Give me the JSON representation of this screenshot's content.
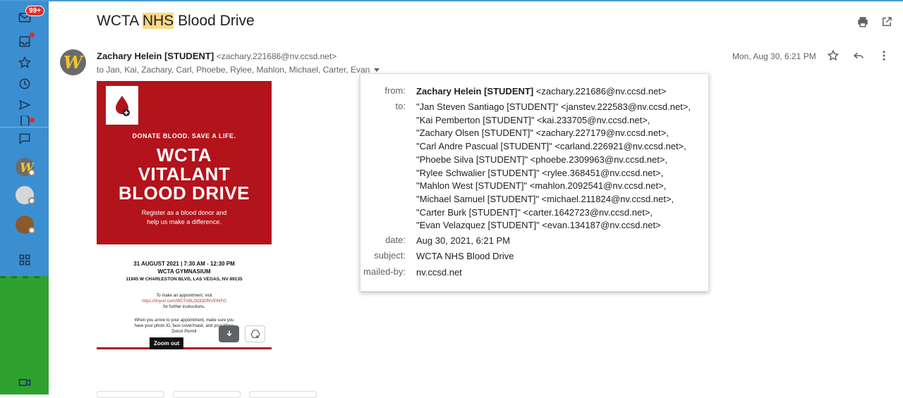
{
  "rail": {
    "mail_badge": "99+",
    "icons": [
      "mail-icon",
      "inbox-icon",
      "star-icon",
      "clock-icon",
      "send-icon",
      "draft-icon",
      "chat-icon",
      "apps-icon",
      "video-icon"
    ]
  },
  "header": {
    "subject_prefix": "WCTA ",
    "subject_highlight": "NHS",
    "subject_suffix": " Blood Drive"
  },
  "message": {
    "avatar_letter": "W",
    "sender_name": "Zachary Helein [STUDENT]",
    "sender_email": "<zachary.221686@nv.ccsd.net>",
    "recipients_summary": "to Jan, Kai, Zachary, Carl, Phoebe, Rylee, Mahlon, Michael, Carter, Evan",
    "datetime": "Mon, Aug 30, 6:21 PM"
  },
  "flyer": {
    "tagline": "DONATE BLOOD. SAVE A LIFE.",
    "title_1": "WCTA",
    "title_2": "VITALANT",
    "title_3": "BLOOD DRIVE",
    "sub_1": "Register as a blood donor and",
    "sub_2": "help us make a difference.",
    "info_1": "31 AUGUST 2021 | 7:30 AM - 12:30 PM",
    "info_2": "WCTA GYMNASIUM",
    "info_3": "11945 W CHARLESTON BLVD, LAS VEGAS, NV 89135",
    "small_1": "To make an appointment, visit",
    "small_link": "https://tinyurl.com/WCTABLOODDRIVEINFO",
    "small_2": "for further instructions.",
    "small_3": "When you arrive to your appointment, make sure you",
    "small_4": "have your photo ID, face cover/mask, and your Minor",
    "small_5": "Donor Permit",
    "zoom_label": "Zoom out"
  },
  "details": {
    "from_label": "from:",
    "from_name": "Zachary Helein [STUDENT]",
    "from_email": "<zachary.221686@nv.ccsd.net>",
    "to_label": "to:",
    "to_list": [
      "\"Jan Steven Santiago [STUDENT]\" <janstev.222583@nv.ccsd.net>,",
      "\"Kai Pemberton [STUDENT]\" <kai.233705@nv.ccsd.net>,",
      "\"Zachary Olsen [STUDENT]\" <zachary.227179@nv.ccsd.net>,",
      "\"Carl Andre Pascual [STUDENT]\" <carland.226921@nv.ccsd.net>,",
      "\"Phoebe Silva [STUDENT]\" <phoebe.2309963@nv.ccsd.net>,",
      "\"Rylee Schwalier [STUDENT]\" <rylee.368451@nv.ccsd.net>,",
      "\"Mahlon West [STUDENT]\" <mahlon.2092541@nv.ccsd.net>,",
      "\"Michael Samuel [STUDENT]\" <michael.211824@nv.ccsd.net>,",
      "\"Carter Burk [STUDENT]\" <carter.1642723@nv.ccsd.net>,",
      "\"Evan Velazquez [STUDENT]\" <evan.134187@nv.ccsd.net>"
    ],
    "date_label": "date:",
    "date_value": "Aug 30, 2021, 6:21 PM",
    "subject_label": "subject:",
    "subject_value": "WCTA NHS Blood Drive",
    "mailedby_label": "mailed-by:",
    "mailedby_value": "nv.ccsd.net"
  },
  "colors": {
    "rail_blue": "#3b8fd1",
    "flyer_red": "#b3131b",
    "highlight": "#fbd885",
    "badge_red": "#d93025"
  }
}
